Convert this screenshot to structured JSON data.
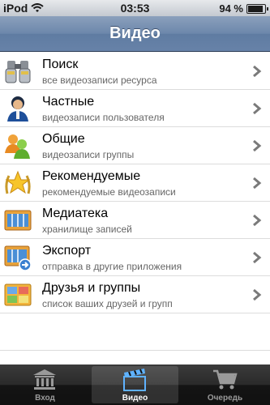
{
  "status_bar": {
    "carrier": "iPod",
    "time": "03:53",
    "battery_percent_label": "94 %",
    "battery_level": 0.94
  },
  "nav_bar": {
    "title": "Видео"
  },
  "list": {
    "items": [
      {
        "title": "Поиск",
        "subtitle": "все видеозаписи ресурса",
        "icon": "binoculars-icon"
      },
      {
        "title": "Частные",
        "subtitle": "видеозаписи пользователя",
        "icon": "user-icon"
      },
      {
        "title": "Общие",
        "subtitle": "видеозаписи группы",
        "icon": "group-icon"
      },
      {
        "title": "Рекомендуемые",
        "subtitle": "рекомендуемые видеозаписи",
        "icon": "star-icon"
      },
      {
        "title": "Медиатека",
        "subtitle": "хранилище записей",
        "icon": "film-icon"
      },
      {
        "title": "Экспорт",
        "subtitle": "отправка в другие приложения",
        "icon": "export-icon"
      },
      {
        "title": "Друзья и группы",
        "subtitle": "список ваших друзей и групп",
        "icon": "friends-icon"
      }
    ]
  },
  "tab_bar": {
    "tabs": [
      {
        "label": "Вход",
        "icon": "bank-icon",
        "active": false
      },
      {
        "label": "Видео",
        "icon": "clapperboard-icon",
        "active": true
      },
      {
        "label": "Очередь",
        "icon": "cart-icon",
        "active": false
      }
    ]
  },
  "colors": {
    "nav_bar": "#6c87ab",
    "tab_bar": "#1c1c1c",
    "chevron": "#7a7a7a"
  }
}
